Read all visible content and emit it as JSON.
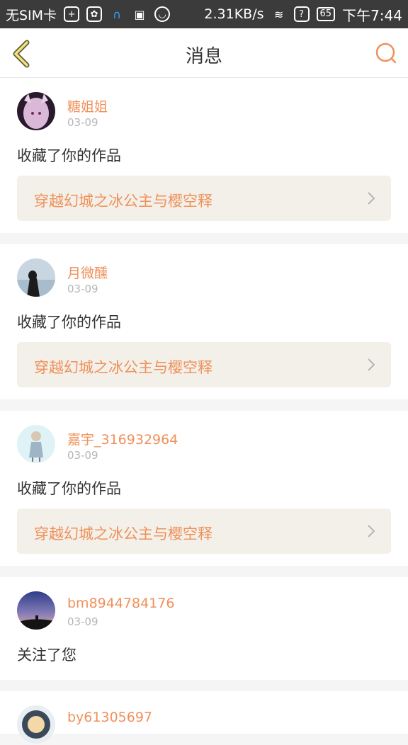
{
  "status_bar": {
    "carrier": "无SIM卡",
    "speed": "2.31KB/s",
    "battery": "65",
    "time": "下午7:44",
    "question_mark": "?"
  },
  "header": {
    "title": "消息",
    "accent_color": "#f0905a"
  },
  "messages": [
    {
      "username": "糖姐姐",
      "date": "03-09",
      "action": "收藏了你的作品",
      "work_title": "穿越幻城之冰公主与樱空释"
    },
    {
      "username": "月微醺",
      "date": "03-09",
      "action": "收藏了你的作品",
      "work_title": "穿越幻城之冰公主与樱空释"
    },
    {
      "username": "嘉宇_316932964",
      "date": "03-09",
      "action": "收藏了你的作品",
      "work_title": "穿越幻城之冰公主与樱空释"
    },
    {
      "username": "bm8944784176",
      "date": "03-09",
      "action": "关注了您"
    },
    {
      "username": "by61305697"
    }
  ]
}
